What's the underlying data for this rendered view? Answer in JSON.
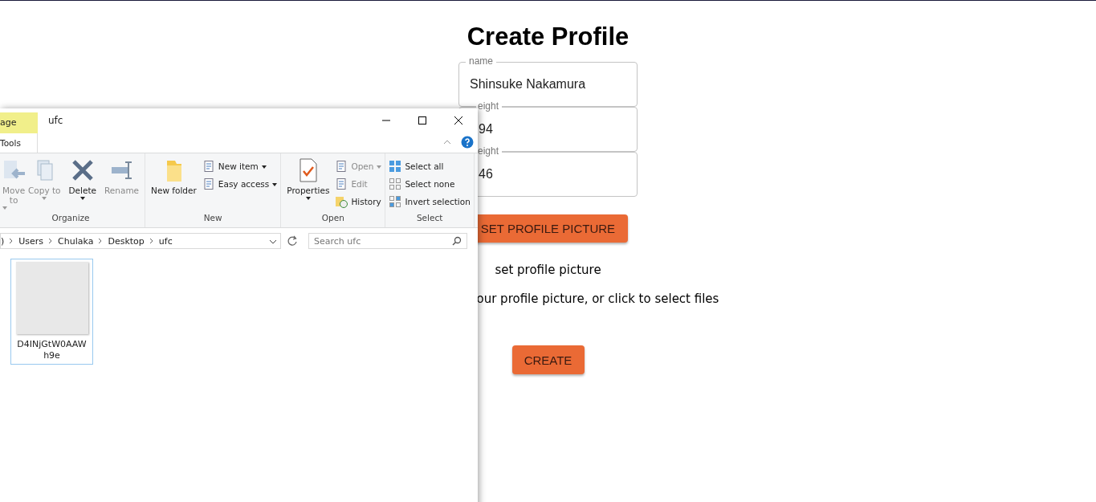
{
  "page": {
    "title": "Create Profile",
    "fields": [
      {
        "label": "name",
        "value": "Shinsuke Nakamura",
        "clipped": false
      },
      {
        "label": "eight",
        "value": "94",
        "clipped": true
      },
      {
        "label": "eight",
        "value": "46",
        "clipped": true
      }
    ],
    "upload_button": "SET PROFILE PICTURE",
    "upload_title": "set profile picture",
    "upload_hint": "our profile picture, or click to select files",
    "create_button": "CREATE"
  },
  "explorer": {
    "context_tab": "age",
    "context_group": "Tools",
    "title": "ufc",
    "groups": [
      {
        "name": "Organize",
        "items": [
          {
            "kind": "large",
            "label": "Move to",
            "disabled": true,
            "menu": true
          },
          {
            "kind": "large",
            "label": "Copy to",
            "disabled": true,
            "menu": true
          },
          {
            "kind": "large",
            "label": "Delete",
            "disabled": false,
            "menu": true
          },
          {
            "kind": "large",
            "label": "Rename",
            "disabled": true,
            "menu": false
          }
        ]
      },
      {
        "name": "New",
        "items": [
          {
            "kind": "large",
            "label": "New folder",
            "disabled": false,
            "menu": false
          },
          {
            "kind": "small",
            "label": "New item",
            "disabled": false,
            "menu": true
          },
          {
            "kind": "small",
            "label": "Easy access",
            "disabled": false,
            "menu": true
          }
        ]
      },
      {
        "name": "Open",
        "items": [
          {
            "kind": "large",
            "label": "Properties",
            "disabled": false,
            "menu": true
          },
          {
            "kind": "small",
            "label": "Open",
            "disabled": true,
            "menu": true
          },
          {
            "kind": "small",
            "label": "Edit",
            "disabled": true,
            "menu": false
          },
          {
            "kind": "small",
            "label": "History",
            "disabled": false,
            "menu": false
          }
        ]
      },
      {
        "name": "Select",
        "items": [
          {
            "kind": "small",
            "label": "Select all",
            "disabled": false,
            "menu": false
          },
          {
            "kind": "small",
            "label": "Select none",
            "disabled": false,
            "menu": false
          },
          {
            "kind": "small",
            "label": "Invert selection",
            "disabled": false,
            "menu": false
          }
        ]
      }
    ],
    "path": [
      ")",
      "Users",
      "Chulaka",
      "Desktop",
      "ufc"
    ],
    "search": {
      "placeholder": "Search ufc"
    },
    "files": [
      {
        "name": "D4INjGtW0AAWh9e",
        "selected": true
      }
    ]
  }
}
